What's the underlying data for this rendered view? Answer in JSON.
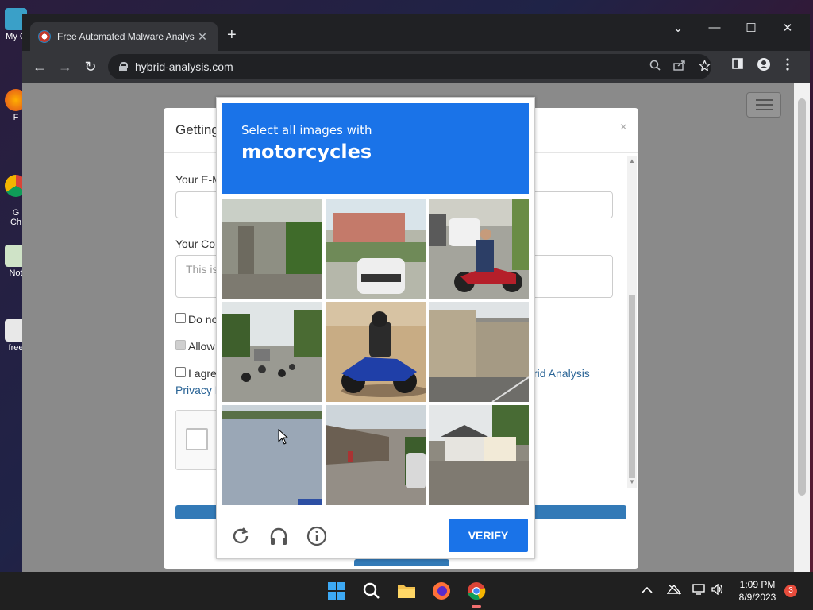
{
  "desktop": {
    "icons": [
      {
        "label": "My C"
      },
      {
        "label": "F"
      },
      {
        "label": "G\nCh"
      },
      {
        "label": "Not"
      },
      {
        "label": "free"
      }
    ]
  },
  "browser": {
    "tab": {
      "title": "Free Automated Malware Analysis",
      "close": "✕"
    },
    "new_tab": "+",
    "window_controls": {
      "dropdown": "⌄",
      "minimize": "—",
      "maximize": "☐",
      "close": "✕"
    },
    "nav": {
      "back": "←",
      "forward": "→",
      "reload": "↻"
    },
    "address": "hybrid-analysis.com"
  },
  "modal": {
    "title": "Getting",
    "close": "×",
    "email_label": "Your E-M",
    "comment_label": "Your Cor",
    "comment_placeholder": "This is",
    "check1_label": "Do no",
    "check2_label": "Allow",
    "check3_label": "I agree",
    "privacy_link": "Privacy N",
    "hybrid_link": "rid Analysis"
  },
  "captcha": {
    "instruction": "Select all images with",
    "target": "motorcycles",
    "verify_label": "VERIFY",
    "tiles": [
      {
        "subject": "bus-stop-sidewalk"
      },
      {
        "subject": "street-with-car"
      },
      {
        "subject": "person-on-motorcycle"
      },
      {
        "subject": "street-with-motorcycles"
      },
      {
        "subject": "rider-on-sport-motorcycle"
      },
      {
        "subject": "street-buildings"
      },
      {
        "subject": "road-surface"
      },
      {
        "subject": "street-with-van"
      },
      {
        "subject": "house-by-road"
      }
    ],
    "colors": {
      "header": "#1a73e8",
      "button": "#1a73e8"
    }
  },
  "taskbar": {
    "apps": [
      "start-icon",
      "search-icon",
      "file-explorer-icon",
      "firefox-icon",
      "chrome-icon"
    ],
    "time": "1:09 PM",
    "date": "8/9/2023",
    "notification_count": "3"
  }
}
